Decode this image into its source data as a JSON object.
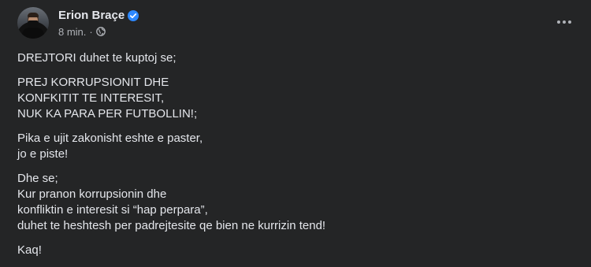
{
  "post": {
    "author": {
      "name": "Erion Braçe",
      "verified": true,
      "avatar_icon": "profile-photo"
    },
    "meta": {
      "time": "8 min.",
      "separator": "·",
      "audience_icon": "globe-icon"
    },
    "menu_icon": "more-horizontal-icon",
    "paragraphs": [
      [
        "DREJTORI duhet te kuptoj se;"
      ],
      [
        "PREJ KORRUPSIONIT DHE",
        "KONFKITIT TE INTERESIT,",
        "NUK KA PARA PER FUTBOLLIN!;"
      ],
      [
        "Pika e ujit zakonisht eshte e paster,",
        "jo e piste!"
      ],
      [
        "Dhe se;",
        "Kur pranon korrupsionin dhe",
        "konfliktin e interesit si “hap perpara”,",
        "duhet te heshtesh per padrejtesite qe bien ne kurrizin tend!"
      ],
      [
        "Kaq!"
      ]
    ]
  },
  "colors": {
    "background": "#242526",
    "primary_text": "#e4e6eb",
    "secondary_text": "#b0b3b8",
    "verified_badge": "#2d88ff"
  }
}
